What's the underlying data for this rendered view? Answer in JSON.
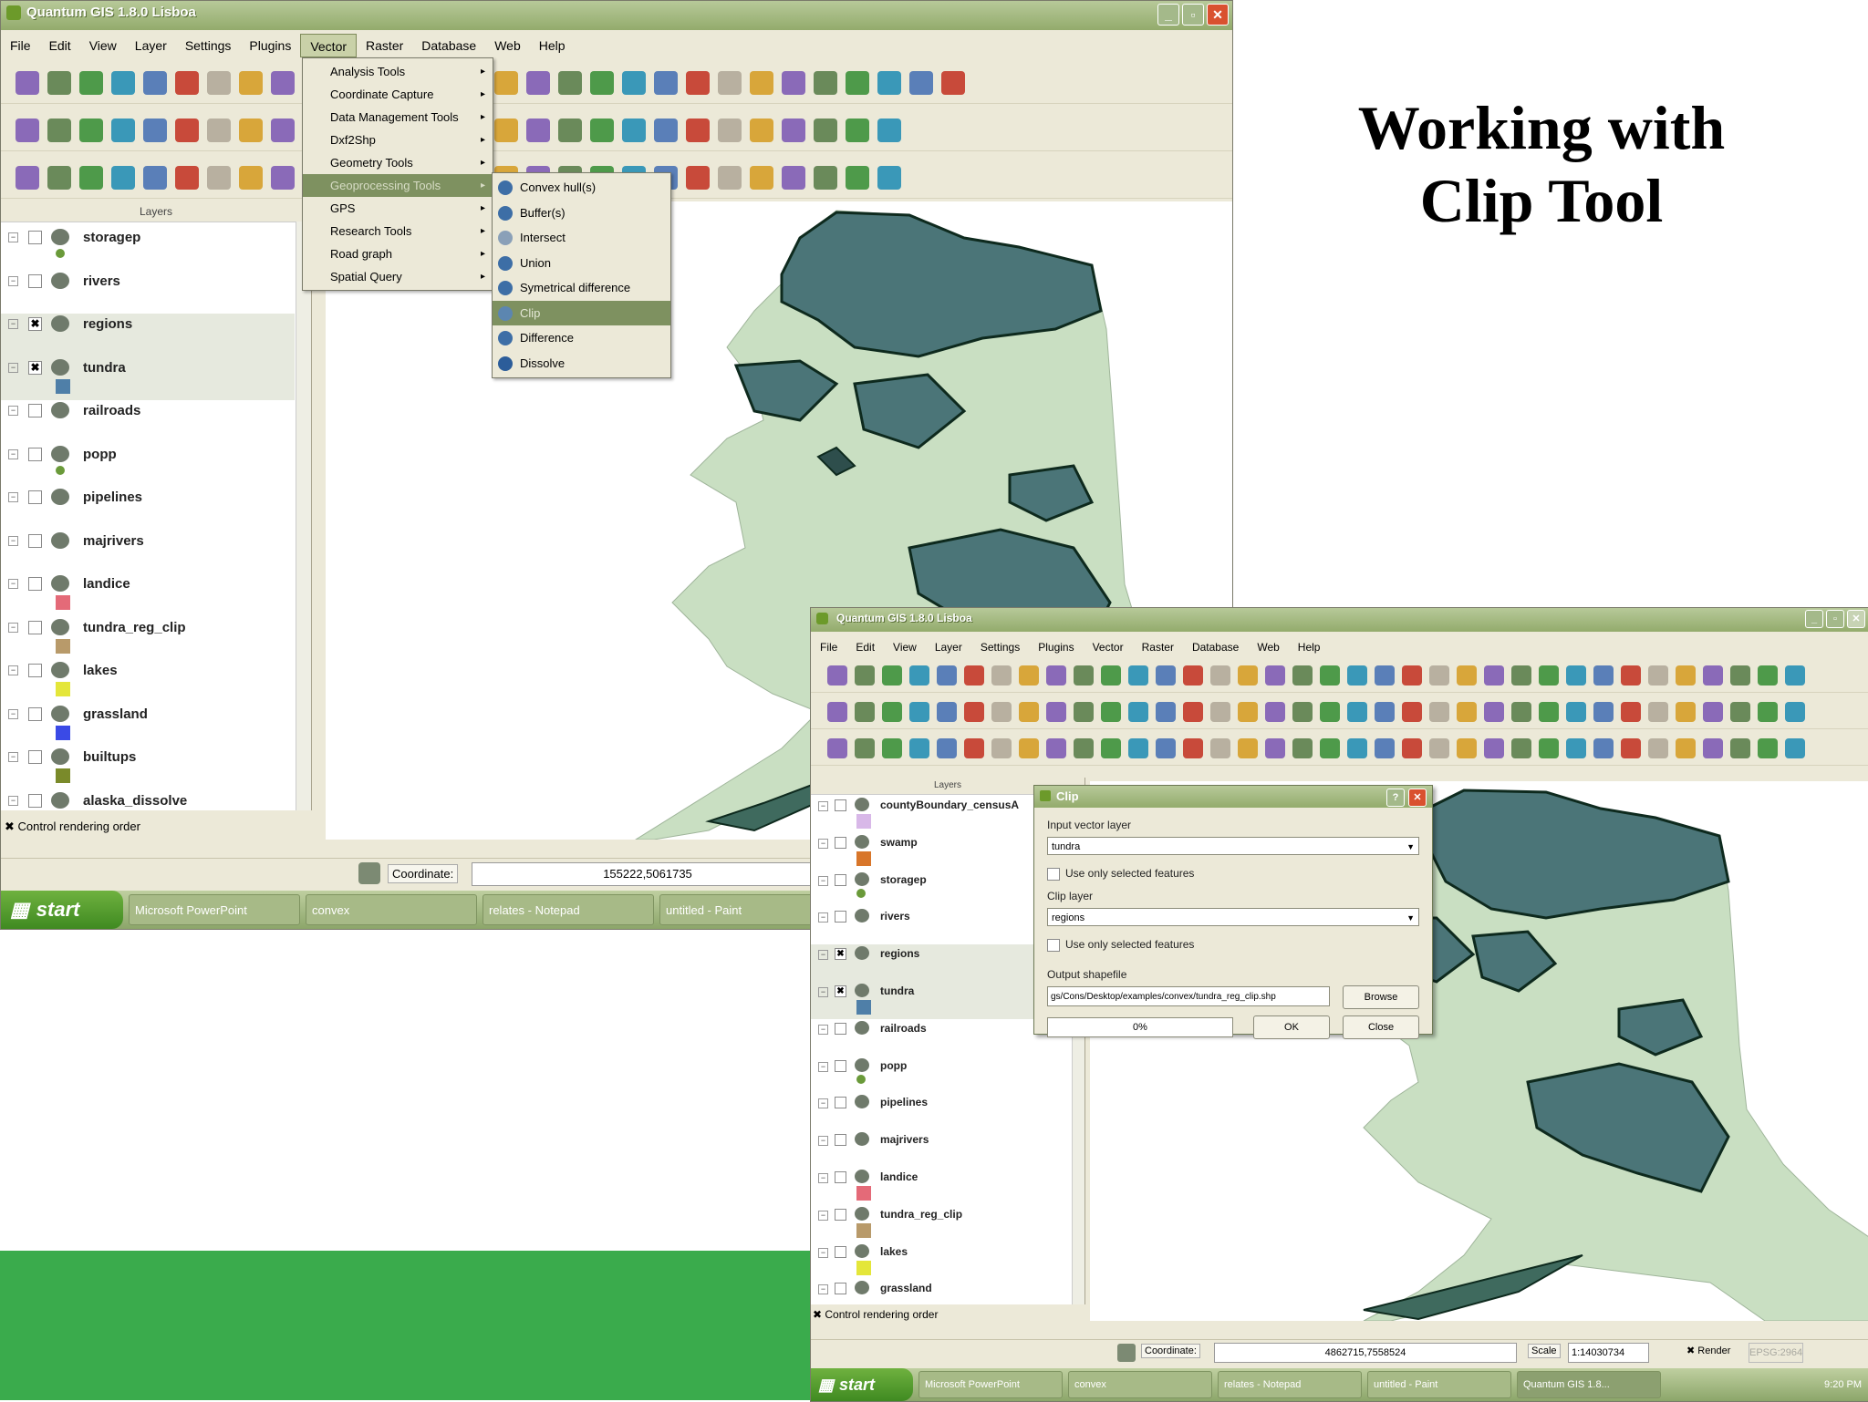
{
  "slide": {
    "title_line1": "Working with",
    "title_line2": "Clip Tool"
  },
  "window1": {
    "title": "Quantum GIS 1.8.0 Lisboa",
    "menus": [
      "File",
      "Edit",
      "View",
      "Layer",
      "Settings",
      "Plugins",
      "Vector",
      "Raster",
      "Database",
      "Web",
      "Help"
    ],
    "layers_header": "Layers",
    "layers": [
      {
        "name": "storagep",
        "checked": false,
        "symbol": "#6a9a3a"
      },
      {
        "name": "rivers",
        "checked": false,
        "symbol": ""
      },
      {
        "name": "regions",
        "checked": true,
        "symbol": ""
      },
      {
        "name": "tundra",
        "checked": true,
        "symbol": "#4f7fa8"
      },
      {
        "name": "railroads",
        "checked": false,
        "symbol": ""
      },
      {
        "name": "popp",
        "checked": false,
        "symbol": "#6a9a3a"
      },
      {
        "name": "pipelines",
        "checked": false,
        "symbol": ""
      },
      {
        "name": "majrivers",
        "checked": false,
        "symbol": ""
      },
      {
        "name": "landice",
        "checked": false,
        "symbol": "#e46a78"
      },
      {
        "name": "tundra_reg_clip",
        "checked": false,
        "symbol": "#b89a6a"
      },
      {
        "name": "lakes",
        "checked": false,
        "symbol": "#e4e63a"
      },
      {
        "name": "grassland",
        "checked": false,
        "symbol": "#3a4ae6"
      },
      {
        "name": "builtups",
        "checked": false,
        "symbol": "#7a8a2a"
      },
      {
        "name": "alaska_dissolve",
        "checked": false,
        "symbol": ""
      }
    ],
    "control_rendering_order": "Control rendering order",
    "vector_menu": [
      {
        "label": "Analysis Tools",
        "submenu": true
      },
      {
        "label": "Coordinate Capture",
        "submenu": true
      },
      {
        "label": "Data Management Tools",
        "submenu": true
      },
      {
        "label": "Dxf2Shp",
        "submenu": true
      },
      {
        "label": "Geometry Tools",
        "submenu": true
      },
      {
        "label": "Geoprocessing Tools",
        "submenu": true,
        "highlighted": true
      },
      {
        "label": "GPS",
        "submenu": true
      },
      {
        "label": "Research Tools",
        "submenu": true
      },
      {
        "label": "Road graph",
        "submenu": true
      },
      {
        "label": "Spatial Query",
        "submenu": true
      }
    ],
    "geoprocessing_submenu": [
      {
        "label": "Convex hull(s)",
        "icon": "convex-hull-icon"
      },
      {
        "label": "Buffer(s)",
        "icon": "buffer-icon"
      },
      {
        "label": "Intersect",
        "icon": "intersect-icon"
      },
      {
        "label": "Union",
        "icon": "union-icon"
      },
      {
        "label": "Symetrical difference",
        "icon": "symmetrical-difference-icon"
      },
      {
        "label": "Clip",
        "icon": "clip-icon",
        "highlighted": true
      },
      {
        "label": "Difference",
        "icon": "difference-icon"
      },
      {
        "label": "Dissolve",
        "icon": "dissolve-icon"
      }
    ],
    "coordinate_label": "Coordinate:",
    "coordinate_value": "155222,5061735",
    "taskbar": {
      "start": "start",
      "tasks": [
        "Microsoft PowerPoint",
        "convex",
        "relates - Notepad",
        "untitled - Paint"
      ]
    }
  },
  "window2": {
    "title": "Quantum GIS 1.8.0 Lisboa",
    "menus": [
      "File",
      "Edit",
      "View",
      "Layer",
      "Settings",
      "Plugins",
      "Vector",
      "Raster",
      "Database",
      "Web",
      "Help"
    ],
    "layers_header": "Layers",
    "layers": [
      {
        "name": "countyBoundary_censusA",
        "checked": false,
        "symbol": "#d8b8e8"
      },
      {
        "name": "swamp",
        "checked": false,
        "symbol": "#d8762a"
      },
      {
        "name": "storagep",
        "checked": false,
        "symbol": "#6a9a3a"
      },
      {
        "name": "rivers",
        "checked": false,
        "symbol": ""
      },
      {
        "name": "regions",
        "checked": true,
        "symbol": ""
      },
      {
        "name": "tundra",
        "checked": true,
        "symbol": "#4f7fa8"
      },
      {
        "name": "railroads",
        "checked": false,
        "symbol": ""
      },
      {
        "name": "popp",
        "checked": false,
        "symbol": "#6a9a3a"
      },
      {
        "name": "pipelines",
        "checked": false,
        "symbol": ""
      },
      {
        "name": "majrivers",
        "checked": false,
        "symbol": ""
      },
      {
        "name": "landice",
        "checked": false,
        "symbol": "#e46a78"
      },
      {
        "name": "tundra_reg_clip",
        "checked": false,
        "symbol": "#b89a6a"
      },
      {
        "name": "lakes",
        "checked": false,
        "symbol": "#e4e63a"
      },
      {
        "name": "grassland",
        "checked": false,
        "symbol": ""
      }
    ],
    "control_rendering_order": "Control rendering order",
    "coordinate_label": "Coordinate:",
    "coordinate_value": "4862715,7558524",
    "scale_label": "Scale",
    "scale_value": "1:14030734",
    "render_label": "Render",
    "epsg": "EPSG:2964",
    "taskbar": {
      "start": "start",
      "tasks": [
        "Microsoft PowerPoint",
        "convex",
        "relates - Notepad",
        "untitled - Paint",
        "Quantum GIS 1.8..."
      ],
      "clock": "9:20 PM"
    }
  },
  "clip_dialog": {
    "title": "Clip",
    "input_layer_label": "Input vector layer",
    "input_layer_value": "tundra",
    "use_selected_1": "Use only selected features",
    "clip_layer_label": "Clip layer",
    "clip_layer_value": "regions",
    "use_selected_2": "Use only selected features",
    "output_label": "Output shapefile",
    "output_value": "gs/Cons/Desktop/examples/convex/tundra_reg_clip.shp",
    "browse": "Browse",
    "progress": "0%",
    "ok": "OK",
    "close": "Close"
  },
  "colors": {
    "land": "#c9dfc2",
    "tundra": "#4b7578",
    "outline": "#0e2a1e",
    "slide_green": "#3aab4c",
    "menu_highlight": "#7e9160"
  }
}
